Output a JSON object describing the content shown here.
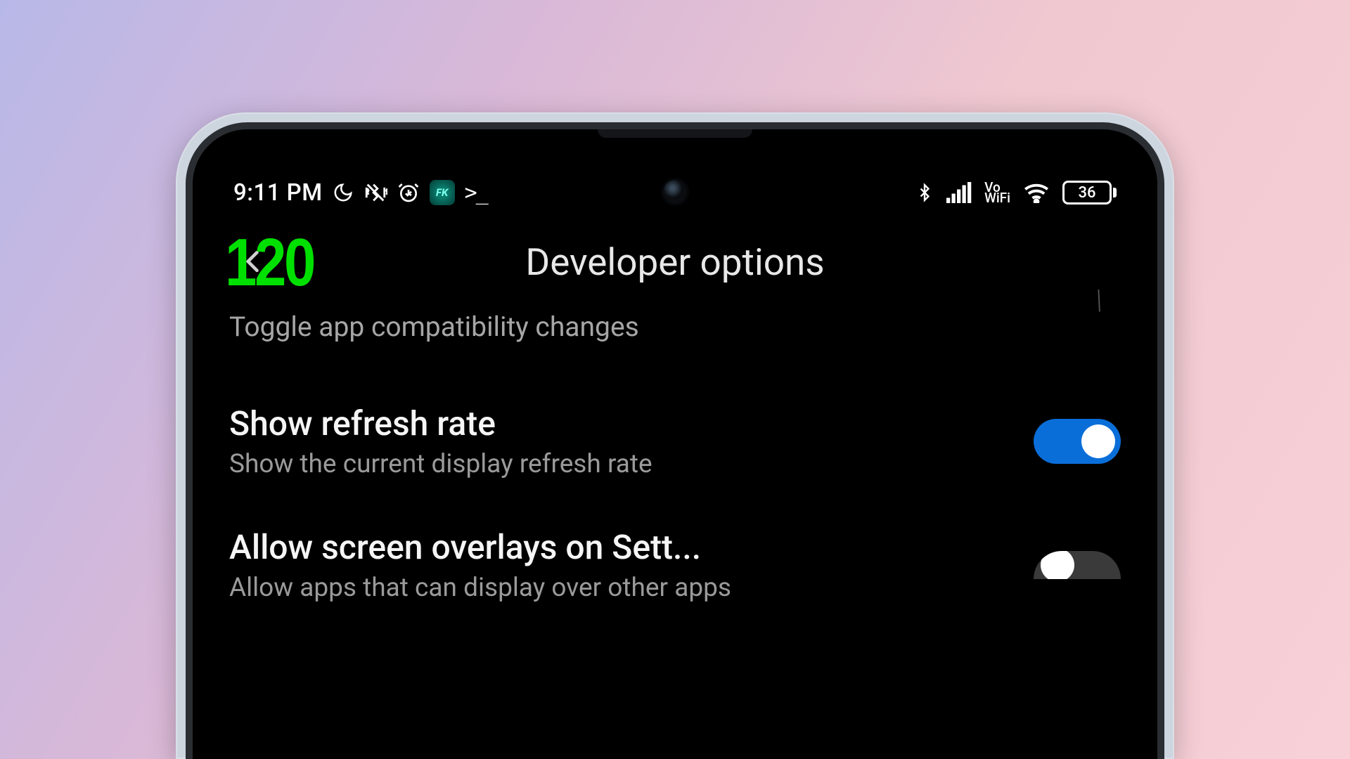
{
  "status_bar": {
    "time": "9:11 PM",
    "icons_left": {
      "dnd": "moon-icon",
      "vibrate": "vibrate-icon",
      "alarm": "alarm-icon",
      "fk_app": "FK",
      "terminal": ">_"
    },
    "icons_right": {
      "bluetooth": "bluetooth-icon",
      "signal": "signal-full",
      "vowifi_top": "Vo",
      "vowifi_bottom": "WiFi",
      "wifi": "wifi-icon",
      "battery_level": "36"
    }
  },
  "overlay": {
    "refresh_rate": "120"
  },
  "header": {
    "title": "Developer options"
  },
  "settings": {
    "item0": {
      "subtitle": "Toggle app compatibility changes"
    },
    "item1": {
      "title": "Show refresh rate",
      "subtitle": "Show the current display refresh rate",
      "toggle": true
    },
    "item2": {
      "title": "Allow screen overlays on Sett...",
      "subtitle": "Allow apps that can display over other apps",
      "toggle": false
    }
  }
}
